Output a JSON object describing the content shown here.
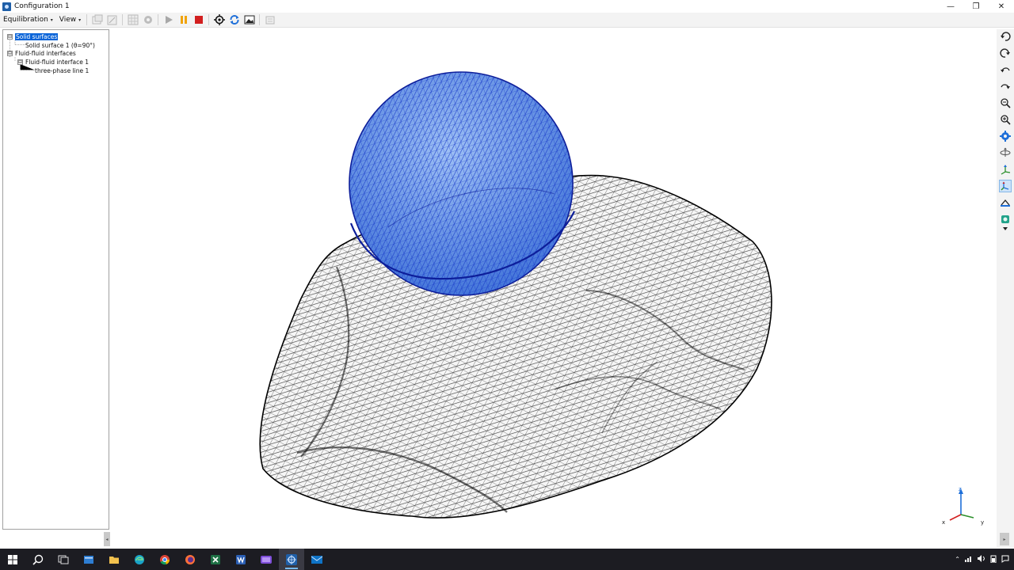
{
  "window": {
    "title": "Configuration 1",
    "controls": {
      "minimize": "—",
      "restore": "❐",
      "close": "✕"
    }
  },
  "toolbar": {
    "menus": [
      {
        "label": "Equilibration",
        "caret": "▾"
      },
      {
        "label": "View",
        "caret": "▾"
      }
    ],
    "icons": [
      "surface-add-icon",
      "surface-edit-icon",
      "grid-icon",
      "settings-icon",
      "play-icon",
      "pause-icon",
      "stop-icon",
      "target-icon",
      "refresh-icon",
      "image-icon",
      "export-icon"
    ],
    "colors": {
      "play": "#9aa0a6",
      "pause": "#f0a30a",
      "stop": "#d21f1f",
      "refresh": "#1e6fd9"
    }
  },
  "tree": {
    "items": [
      {
        "label": "Solid surfaces",
        "expander": "⊟",
        "selected": true
      },
      {
        "label": "Solid surface 1 (θ=90°)"
      },
      {
        "label": "Fluid-fluid interfaces",
        "expander": "⊟"
      },
      {
        "label": "Fluid-fluid interface 1",
        "expander": "⊟"
      },
      {
        "label": "three-phase line 1"
      }
    ]
  },
  "viewport": {
    "solid_mesh_color": "#111111",
    "droplet_mesh_color": "#1535c8",
    "droplet_fill_color": "#5a8fe8",
    "axes": {
      "x_label": "x",
      "y_label": "y",
      "z_label": "z"
    }
  },
  "right_toolbar": {
    "icons": [
      "rotate-ccw-icon",
      "rotate-cw-icon",
      "undo-icon",
      "redo-icon",
      "zoom-out-icon",
      "zoom-in-icon",
      "gear-icon",
      "axis-rotate-icon",
      "axis-z-icon",
      "axis-y-icon",
      "camera-icon",
      "surface-icon"
    ],
    "active": "axis-y-icon"
  },
  "taskbar": {
    "apps": [
      "windows-start-icon",
      "search-icon",
      "task-view-icon",
      "explorer-icon",
      "file-manager-icon",
      "edge-icon",
      "chrome-icon",
      "firefox-icon",
      "excel-icon",
      "word-icon",
      "media-icon",
      "config-app-icon",
      "mail-icon"
    ],
    "active": "config-app-icon"
  }
}
